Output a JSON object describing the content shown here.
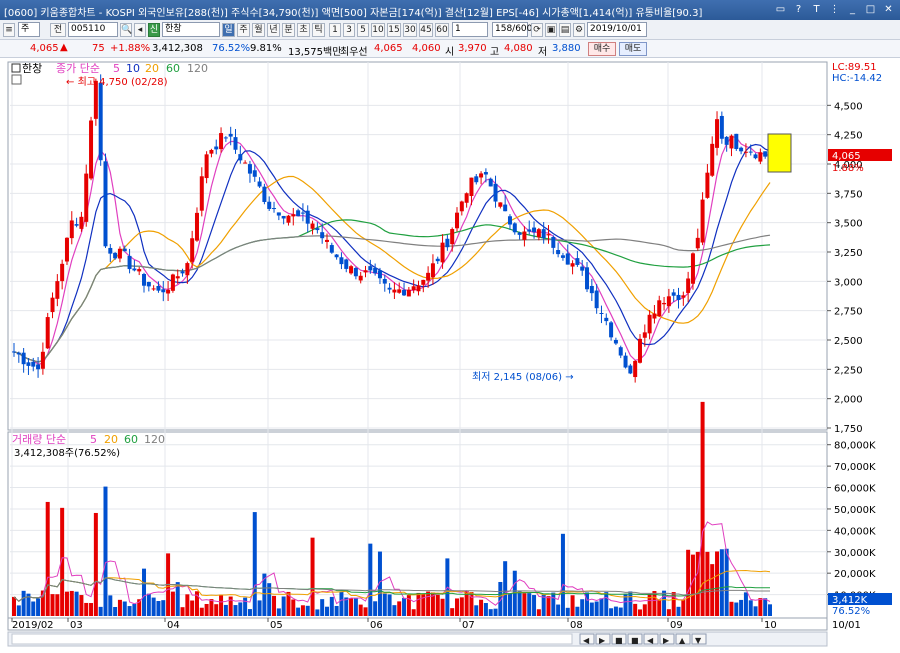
{
  "window": {
    "title": "[0600] 키움종합차트 - KOSPI 외국인보유[288(천)] 주식수[34,790(천)] 액면[500] 자본금[174(억)] 결산[12월] EPS[-46] 시가총액[1,414(억)] 유통비율[90.3]",
    "icons": [
      "restore-icon",
      "help-icon",
      "pin-icon",
      "tile-icon",
      "minimize-icon",
      "maximize-icon",
      "close-icon"
    ]
  },
  "toolbar": {
    "market_select": "주",
    "prev_label": "전",
    "code_value": "005110",
    "name_badge": "신",
    "name_value": "한창",
    "period_buttons": [
      "일",
      "주",
      "월",
      "년",
      "분",
      "초",
      "틱"
    ],
    "minute_buttons": [
      "1",
      "3",
      "5",
      "10",
      "15",
      "30",
      "45",
      "60"
    ],
    "interval_value": "1",
    "count_value": "158/600",
    "date_value": "2019/10/01"
  },
  "quote": {
    "price": "4,065",
    "change": "75",
    "change_pct": "+1.88%",
    "volume": "3,412,308",
    "vol_ratio": "76.52%",
    "turnover": "9.81%",
    "amount": "13,575백만",
    "best_ask_label": "최우선",
    "ask": "4,065",
    "bid": "4,060",
    "open_label": "시",
    "open": "3,970",
    "high_label": "고",
    "high": "4,080",
    "low_label": "저",
    "low": "3,880",
    "buy_label": "매수",
    "sell_label": "매도",
    "up_color": "#e60000",
    "down_color": "#0050d0"
  },
  "price_panel": {
    "name_label": "한창",
    "legend_prefix": "종가 단순",
    "ma": [
      {
        "period": "5",
        "color": "#e040c0"
      },
      {
        "period": "10",
        "color": "#1030c0"
      },
      {
        "period": "20",
        "color": "#f0a000"
      },
      {
        "period": "60",
        "color": "#20a040"
      },
      {
        "period": "120",
        "color": "#808080"
      }
    ],
    "high_annotation": "최고 4,750 (02/28)",
    "low_annotation": "최저 2,145 (08/06)",
    "lc_label": "LC:89.51",
    "hc_label": "HC:-14.42",
    "current_price": "4,065",
    "current_pct": "1.88%",
    "y_ticks": [
      "4,500",
      "4,250",
      "4,000",
      "3,750",
      "3,500",
      "3,250",
      "3,000",
      "2,750",
      "2,500",
      "2,250",
      "2,000",
      "1,750"
    ]
  },
  "volume_panel": {
    "legend_prefix": "거래량 단순",
    "ma": [
      {
        "period": "5",
        "color": "#e040c0"
      },
      {
        "period": "20",
        "color": "#f0a000"
      },
      {
        "period": "60",
        "color": "#20a040"
      },
      {
        "period": "120",
        "color": "#808080"
      }
    ],
    "current_volume_label": "3,412,308주(76.52%)",
    "current_k": "3,412K",
    "current_pct": "76.52%",
    "y_ticks": [
      "80,000K",
      "70,000K",
      "60,000K",
      "50,000K",
      "40,000K",
      "30,000K",
      "20,000K",
      "10,000K"
    ]
  },
  "x_axis": {
    "labels": [
      "2019/02",
      "03",
      "04",
      "05",
      "06",
      "07",
      "08",
      "09",
      "10"
    ],
    "right_label": "10/01"
  },
  "scroll_buttons": [
    "◀",
    "▶",
    "■",
    "■",
    "◀",
    "▶",
    "▲",
    "▼"
  ]
}
